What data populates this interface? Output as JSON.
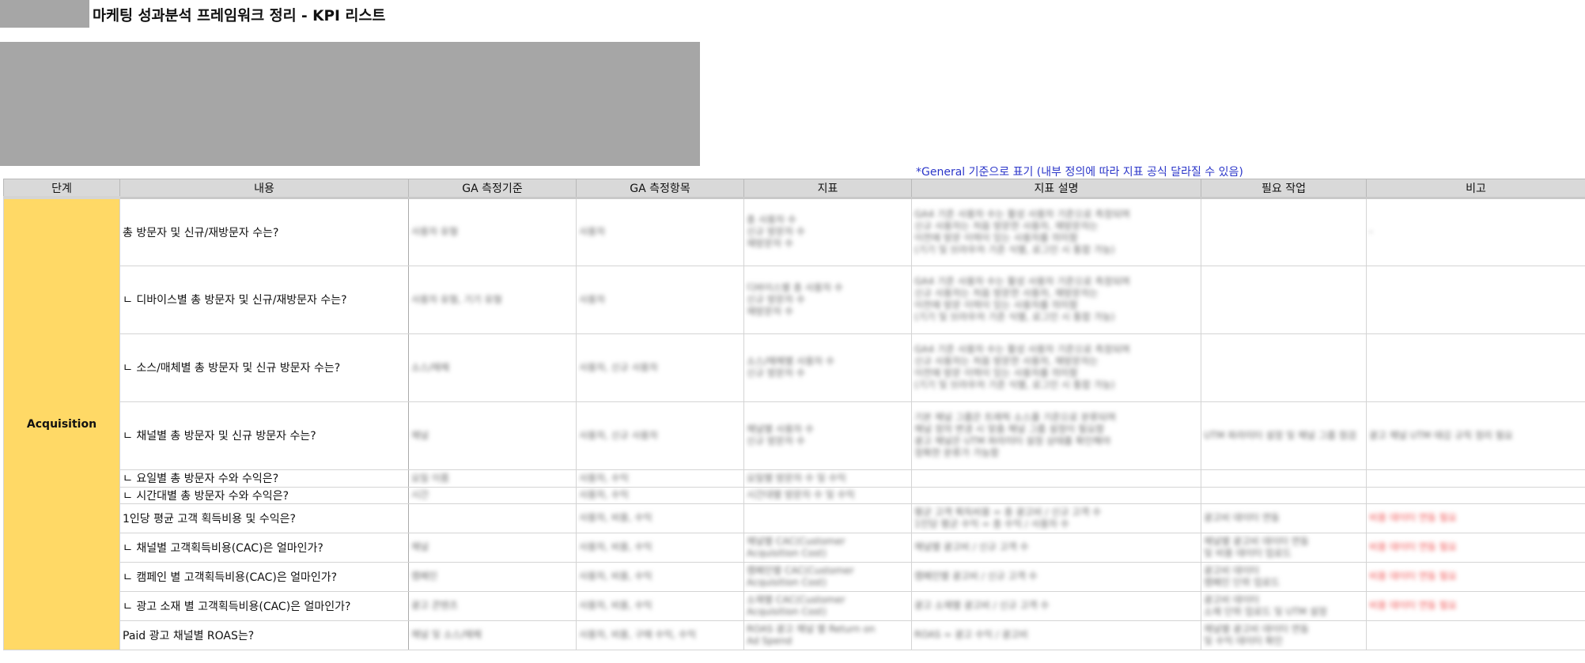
{
  "document": {
    "title": "마케팅 성과분석 프레임워크 정리 - KPI 리스트",
    "note": "*General 기준으로 표기 (내부 정의에 따라 지표 공식 달라질 수 있음)"
  },
  "table": {
    "headers": [
      "단계",
      "내용",
      "GA 측정기준",
      "GA 측정항목",
      "지표",
      "지표 설명",
      "필요 작업",
      "비고"
    ],
    "stage": "Acquisition",
    "rows": [
      {
        "question": "총 방문자 및 신규/재방문자 수는?",
        "dimension": "사용자 유형",
        "metric": "사용자",
        "kpi": "총 사용자 수\n신규 방문자 수\n재방문자 수",
        "desc": "GA4 기준 사용자 수는 활성 사용자 기준으로 측정되며\n신규 사용자는 처음 방문한 사용자, 재방문자는\n이전에 방문 이력이 있는 사용자를 의미함\n(기기 및 브라우저 기준 식별, 로그인 시 통합 가능)\n",
        "task": "",
        "memo": "-"
      },
      {
        "question": "ㄴ 디바이스별 총 방문자 및 신규/재방문자 수는?",
        "dimension": "사용자 유형, 기기 유형",
        "metric": "사용자",
        "kpi": "디바이스별 총 사용자 수\n신규 방문자 수\n재방문자 수",
        "desc": "GA4 기준 사용자 수는 활성 사용자 기준으로 측정되며\n신규 사용자는 처음 방문한 사용자, 재방문자는\n이전에 방문 이력이 있는 사용자를 의미함\n(기기 및 브라우저 기준 식별, 로그인 시 통합 가능)\n",
        "task": "",
        "memo": ""
      },
      {
        "question": "ㄴ 소스/매체별 총 방문자 및 신규 방문자 수는?",
        "dimension": "소스/매체",
        "metric": "사용자, 신규 사용자",
        "kpi": "소스/매체별 사용자 수\n신규 방문자 수",
        "desc": "GA4 기준 사용자 수는 활성 사용자 기준으로 측정되며\n신규 사용자는 처음 방문한 사용자, 재방문자는\n이전에 방문 이력이 있는 사용자를 의미함\n(기기 및 브라우저 기준 식별, 로그인 시 통합 가능)\n",
        "task": "",
        "memo": ""
      },
      {
        "question": "ㄴ 채널별 총 방문자 및 신규 방문자 수는?",
        "dimension": "채널",
        "metric": "사용자, 신규 사용자",
        "kpi": "채널별 사용자 수\n신규 방문자 수",
        "desc": "기본 채널 그룹은 트래픽 소스를 기준으로 분류되며\n채널 정의 변경 시 맞춤 채널 그룹 설정이 필요함\n광고 채널은 UTM 파라미터 설정 상태를 확인해야\n정확한 분류가 가능함\n",
        "task": "UTM 파라미터 설정 및 채널 그룹 점검",
        "memo": "광고 채널 UTM 태깅 규칙 정리 필요"
      },
      {
        "question": "ㄴ 요일별 총 방문자 수와 수익은?",
        "dimension": "요일 이름",
        "metric": "사용자, 수익",
        "kpi": "요일별 방문자 수 및 수익",
        "desc": "",
        "task": "",
        "memo": ""
      },
      {
        "question": "ㄴ 시간대별 총 방문자 수와 수익은?",
        "dimension": "시간",
        "metric": "사용자, 수익",
        "kpi": "시간대별 방문자 수 및 수익",
        "desc": "",
        "task": "",
        "memo": ""
      },
      {
        "question": "1인당 평균 고객 획득비용 및 수익은?",
        "dimension": "",
        "metric": "사용자, 비용, 수익",
        "kpi": "",
        "desc": "평균 고객 획득비용 = 총 광고비 / 신규 고객 수\n1인당 평균 수익 = 총 수익 / 사용자 수",
        "task": "광고비 데이터 연동",
        "memo": "비용 데이터 연동 필요"
      },
      {
        "question": "ㄴ 채널별 고객획득비용(CAC)은 얼마인가?",
        "dimension": "채널",
        "metric": "사용자, 비용, 수익",
        "kpi": "채널별 CAC(Customer\nAcquisition Cost)",
        "desc": "채널별 광고비 / 신규 고객 수",
        "task": "채널별 광고비 데이터 연동\n및 비용 데이터 업로드",
        "memo": "비용 데이터 연동 필요"
      },
      {
        "question": "ㄴ 캠페인 별 고객획득비용(CAC)은 얼마인가?",
        "dimension": "캠페인",
        "metric": "사용자, 비용, 수익",
        "kpi": "캠페인별 CAC(Customer\nAcquisition Cost)",
        "desc": "캠페인별 광고비 / 신규 고객 수",
        "task": "광고비 데이터\n캠페인 단위 업로드",
        "memo": "비용 데이터 연동 필요"
      },
      {
        "question": "ㄴ 광고 소재 별 고객획득비용(CAC)은 얼마인가?",
        "dimension": "광고 콘텐츠",
        "metric": "사용자, 비용, 수익",
        "kpi": "소재별 CAC(Customer\nAcquisition Cost)",
        "desc": "광고 소재별 광고비 / 신규 고객 수",
        "task": "광고비 데이터\n소재 단위 업로드 및 UTM 설정",
        "memo": "비용 데이터 연동 필요"
      },
      {
        "question": "Paid 광고 채널별 ROAS는?",
        "dimension": "채널 및 소스/매체",
        "metric": "사용자, 비용, 구매 수익, 수익",
        "kpi": "ROAS 광고 채널 별 Return on\nAd Spend",
        "desc": "ROAS = 광고 수익 / 광고비",
        "task": "채널별 광고비 데이터 연동\n및 수익 데이터 확인",
        "memo": ""
      }
    ]
  },
  "colors": {
    "stage_fill": "#ffd966",
    "header_fill": "#d9d9d9",
    "placeholder_gray": "#a6a6a6",
    "note_blue": "#2b36c9",
    "memo_red": "#f05050"
  }
}
